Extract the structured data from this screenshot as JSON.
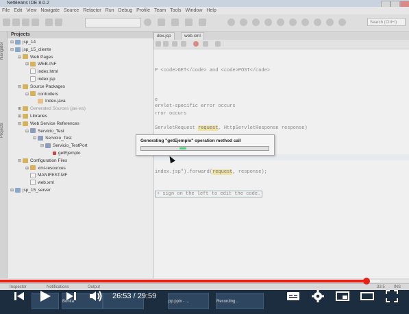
{
  "window": {
    "title": "NetBeans IDE 8.0.2"
  },
  "menu": [
    "File",
    "Edit",
    "View",
    "Navigate",
    "Source",
    "Refactor",
    "Run",
    "Debug",
    "Profile",
    "Team",
    "Tools",
    "Window",
    "Help"
  ],
  "toolbar": {
    "search_placeholder": "Search (Ctrl+I)"
  },
  "left_tabs": [
    "Navigator",
    "Projects"
  ],
  "projects": {
    "title": "Projects",
    "tree": [
      {
        "label": "jsp_14",
        "indent": 0,
        "icon": "project-icon",
        "toggle": "+"
      },
      {
        "label": "jsp_15_cliente",
        "indent": 0,
        "icon": "project-icon",
        "toggle": "-"
      },
      {
        "label": "Web Pages",
        "indent": 1,
        "icon": "folder-icon",
        "toggle": "-"
      },
      {
        "label": "WEB-INF",
        "indent": 2,
        "icon": "folder-icon",
        "toggle": "+"
      },
      {
        "label": "index.html",
        "indent": 2,
        "icon": "file-icon",
        "toggle": ""
      },
      {
        "label": "index.jsp",
        "indent": 2,
        "icon": "file-icon",
        "toggle": ""
      },
      {
        "label": "Source Packages",
        "indent": 1,
        "icon": "folder-icon",
        "toggle": "-"
      },
      {
        "label": "controllers",
        "indent": 2,
        "icon": "package-icon",
        "toggle": "-"
      },
      {
        "label": "Index.java",
        "indent": 3,
        "icon": "java-file-icon",
        "toggle": ""
      },
      {
        "label": "Generated Sources (jax-ws)",
        "indent": 1,
        "icon": "folder-icon",
        "toggle": "+",
        "dim": true
      },
      {
        "label": "Libraries",
        "indent": 1,
        "icon": "folder-icon",
        "toggle": "+"
      },
      {
        "label": "Web Service References",
        "indent": 1,
        "icon": "folder-icon",
        "toggle": "-"
      },
      {
        "label": "Servicio_Test",
        "indent": 2,
        "icon": "service-icon",
        "toggle": "-"
      },
      {
        "label": "Servicio_Test",
        "indent": 3,
        "icon": "service-icon",
        "toggle": "-"
      },
      {
        "label": "Servicio_TestPort",
        "indent": 4,
        "icon": "port-icon",
        "toggle": "-"
      },
      {
        "label": "getEjemplo",
        "indent": 5,
        "icon": "operation-icon",
        "toggle": ""
      },
      {
        "label": "Configuration Files",
        "indent": 1,
        "icon": "folder-icon",
        "toggle": "-"
      },
      {
        "label": "xml-resources",
        "indent": 2,
        "icon": "folder-icon",
        "toggle": "+"
      },
      {
        "label": "MANIFEST.MF",
        "indent": 2,
        "icon": "file-icon",
        "toggle": ""
      },
      {
        "label": "web.xml",
        "indent": 2,
        "icon": "file-icon",
        "toggle": ""
      },
      {
        "label": "jsp_15_server",
        "indent": 0,
        "icon": "project-icon",
        "toggle": "+"
      }
    ]
  },
  "editor": {
    "tabs": [
      "dex.jsp",
      "web.xml"
    ],
    "lines": [
      {
        "parts": [
          {
            "t": "P <code>GET</code> and <code>POST</code>",
            "c": ""
          }
        ]
      },
      {
        "parts": [
          {
            "t": "e",
            "c": ""
          }
        ]
      },
      {
        "parts": [
          {
            "t": "ervlet-specific error occurs",
            "c": ""
          }
        ]
      },
      {
        "parts": [
          {
            "t": "rror occurs",
            "c": ""
          }
        ]
      },
      {
        "parts": [
          {
            "t": "ServletRequest ",
            "c": ""
          },
          {
            "t": "request",
            "c": "hl"
          },
          {
            "t": ", HttpServletResponse response)",
            "c": ""
          }
        ]
      },
      {
        "parts": [
          {
            "t": "index.jsp\").forward(",
            "c": ""
          },
          {
            "t": "request",
            "c": "hl"
          },
          {
            "t": ", response);",
            "c": ""
          }
        ]
      },
      {
        "parts": [
          {
            "t": "+ sign on the left to edit the code.",
            "c": "boxed"
          }
        ]
      }
    ]
  },
  "dialog": {
    "message": "Generating \"getEjemplo\" operation method call",
    "progress": 0.3
  },
  "statusbar": {
    "inspector": "Inspector",
    "notifications": "Notifications",
    "output": "Output",
    "position": "33:5",
    "mode": "INS"
  },
  "taskbar": {
    "items": [
      "Bonita",
      "pp.pptx - ...",
      "Recording..."
    ]
  },
  "video": {
    "current_time": "26:53",
    "separator": " / ",
    "duration": "29:59",
    "played": 0.8968,
    "loaded": 0.93
  }
}
